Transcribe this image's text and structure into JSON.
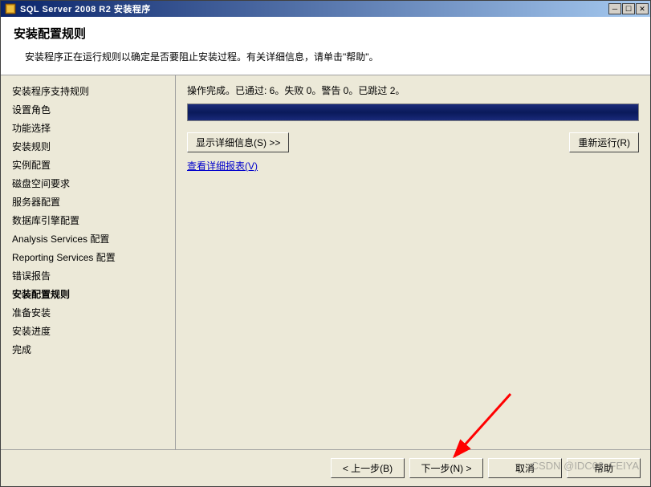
{
  "titlebar": {
    "title": "SQL Server 2008 R2 安装程序"
  },
  "header": {
    "title": "安装配置规则",
    "description": "安装程序正在运行规则以确定是否要阻止安装过程。有关详细信息，请单击\"帮助\"。"
  },
  "sidebar": {
    "items": [
      {
        "label": "安装程序支持规则",
        "current": false
      },
      {
        "label": "设置角色",
        "current": false
      },
      {
        "label": "功能选择",
        "current": false
      },
      {
        "label": "安装规则",
        "current": false
      },
      {
        "label": "实例配置",
        "current": false
      },
      {
        "label": "磁盘空间要求",
        "current": false
      },
      {
        "label": "服务器配置",
        "current": false
      },
      {
        "label": "数据库引擎配置",
        "current": false
      },
      {
        "label": "Analysis Services 配置",
        "current": false
      },
      {
        "label": "Reporting Services 配置",
        "current": false
      },
      {
        "label": "错误报告",
        "current": false
      },
      {
        "label": "安装配置规则",
        "current": true
      },
      {
        "label": "准备安装",
        "current": false
      },
      {
        "label": "安装进度",
        "current": false
      },
      {
        "label": "完成",
        "current": false
      }
    ]
  },
  "content": {
    "status": "操作完成。已通过: 6。失败 0。警告 0。已跳过 2。",
    "show_details": "显示详细信息(S) >>",
    "rerun": "重新运行(R)",
    "view_report": "查看详细报表(V)"
  },
  "footer": {
    "back": "< 上一步(B)",
    "next": "下一步(N) >",
    "cancel": "取消",
    "help": "帮助"
  },
  "watermark": "CSDN @IDC02_FEIYA"
}
